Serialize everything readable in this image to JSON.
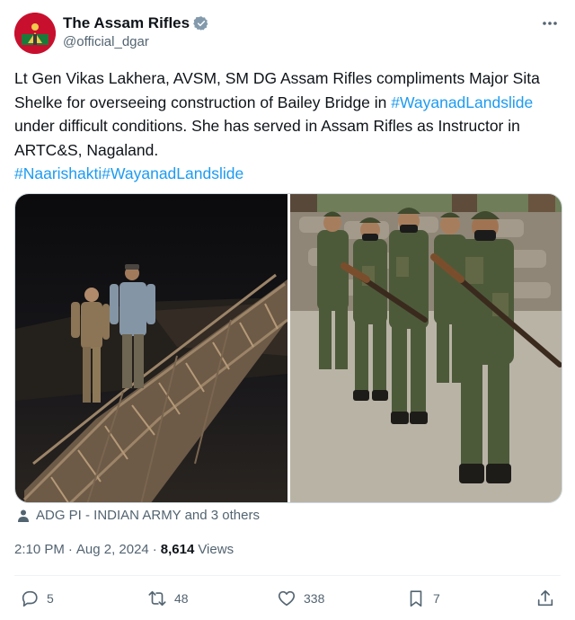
{
  "author": {
    "name": "The Assam Rifles",
    "handle": "@official_dgar",
    "verified": true
  },
  "tweet": {
    "text_part1": "Lt Gen Vikas Lakhera,  AVSM, SM DG Assam Rifles compliments Major Sita Shelke for overseeing construction of Bailey Bridge in ",
    "hashtag_inline": "#WayanadLandslide",
    "text_part2": " under difficult conditions. She has served in Assam Rifles as Instructor in ARTC&S, Nagaland.",
    "hashtags_line": "#Naarishakti#WayanadLandslide"
  },
  "tagged": "ADG PI - INDIAN ARMY and 3 others",
  "meta": {
    "time": "2:10 PM",
    "separator": "·",
    "date": "Aug 2, 2024",
    "separator2": "·",
    "views_count": "8,614",
    "views_label": "Views"
  },
  "actions": {
    "replies": "5",
    "retweets": "48",
    "likes": "338",
    "bookmarks": "7"
  },
  "colors": {
    "link": "#1d9bf0",
    "secondary_text": "#536471",
    "primary_text": "#0f1419",
    "verified_badge": "#829aab"
  },
  "icons": {
    "more": "more-horizontal-icon",
    "verified": "verified-badge-icon",
    "tagged": "person-icon",
    "reply": "reply-icon",
    "retweet": "retweet-icon",
    "like": "heart-icon",
    "bookmark": "bookmark-icon",
    "share": "share-icon"
  }
}
